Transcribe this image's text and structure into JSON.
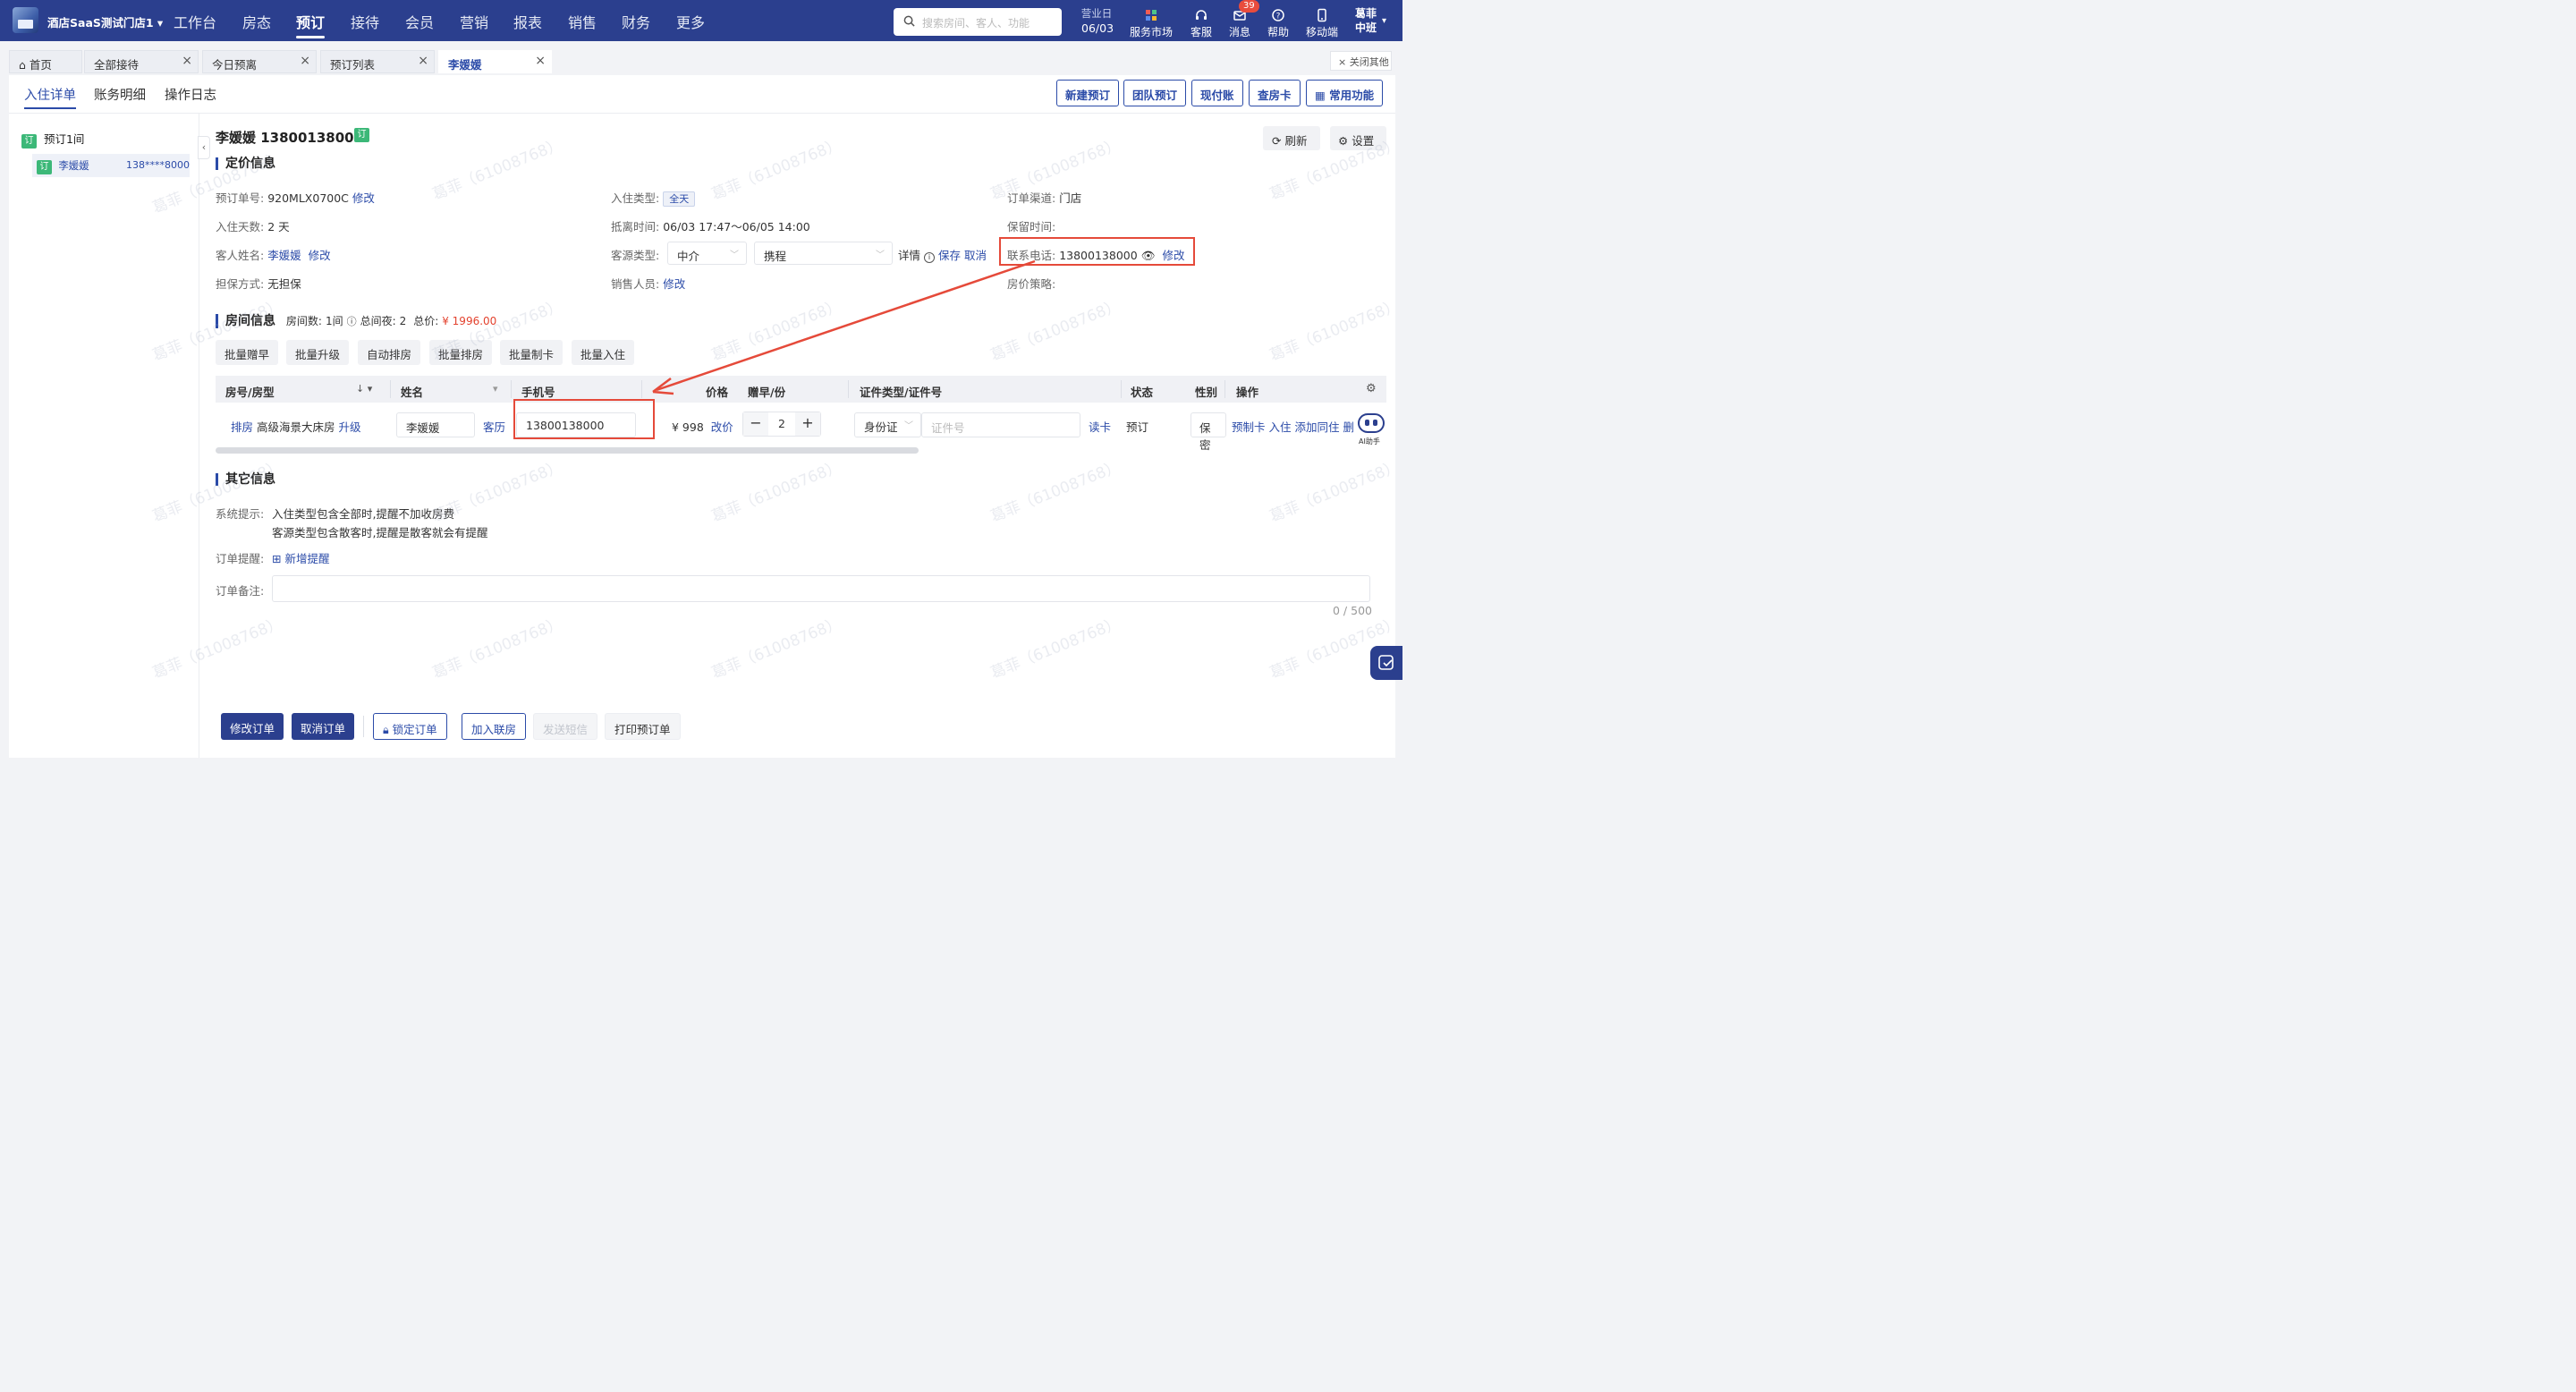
{
  "nav": {
    "store": "酒店SaaS测试门店1",
    "items": [
      "工作台",
      "房态",
      "预订",
      "接待",
      "会员",
      "营销",
      "报表",
      "销售",
      "财务",
      "更多"
    ],
    "search_placeholder": "搜索房间、客人、功能",
    "bizday_label": "营业日",
    "bizday_date": "06/03",
    "tools": [
      "服务市场",
      "客服",
      "消息",
      "帮助",
      "移动端"
    ],
    "msg_badge": "39",
    "user_name": "葛菲",
    "user_shift": "中班"
  },
  "tabs": [
    "首页",
    "全部接待",
    "今日预离",
    "预订列表",
    "李媛媛"
  ],
  "close_others": "× 关闭其他",
  "subtabs": [
    "入住详单",
    "账务明细",
    "操作日志"
  ],
  "actions": [
    "新建预订",
    "团队预订",
    "现付账",
    "查房卡",
    "常用功能"
  ],
  "tree": {
    "root": "预订1间",
    "guest": "李媛媛",
    "phone": "138****8000",
    "tag": "订"
  },
  "header": {
    "name_phone": "李媛媛 13800138000",
    "tag": "订",
    "refresh": "刷新",
    "settings": "设置"
  },
  "pricing": {
    "title": "定价信息",
    "order_no_label": "预订单号:",
    "order_no": "920MLX0700C",
    "modify": "修改",
    "days_label": "入住天数:",
    "days": "2 天",
    "guest_label": "客人姓名:",
    "guest": "李媛媛",
    "guarantee_label": "担保方式:",
    "guarantee": "无担保",
    "checkin_type_label": "入住类型:",
    "checkin_type": "全天",
    "arrive_label": "抵离时间:",
    "arrive": "06/03 17:47～06/05 14:00",
    "source_label": "客源类型:",
    "source1": "中介",
    "source2": "携程",
    "detail": "详情",
    "save": "保存",
    "cancel": "取消",
    "sales_label": "销售人员:",
    "channel_label": "订单渠道:",
    "channel": "门店",
    "retain_label": "保留时间:",
    "contact_label": "联系电话:",
    "contact": "13800138000",
    "policy_label": "房价策略:"
  },
  "room": {
    "title": "房间信息",
    "count_label": "房间数:",
    "count": "1间",
    "nights_label": "总间夜:",
    "nights": "2",
    "total_label": "总价:",
    "total": "¥ 1996.00",
    "batch": [
      "批量赠早",
      "批量升级",
      "自动排房",
      "批量排房",
      "批量制卡",
      "批量入住"
    ],
    "columns": [
      "房号/房型",
      "姓名",
      "手机号",
      "价格",
      "赠早/份",
      "证件类型/证件号",
      "状态",
      "性别",
      "操作"
    ],
    "row": {
      "assign": "排房",
      "type": "高级海景大床房",
      "upgrade": "升级",
      "name": "李媛媛",
      "history": "客历",
      "phone": "13800138000",
      "price": "¥ 998",
      "change_price": "改价",
      "breakfast": "2",
      "id_type": "身份证",
      "id_placeholder": "证件号",
      "read_card": "读卡",
      "status": "预订",
      "gender": "保密",
      "ops": [
        "预制卡",
        "入住",
        "添加同住",
        "删"
      ]
    }
  },
  "other": {
    "title": "其它信息",
    "tip_label": "系统提示:",
    "tip1": "入住类型包含全部时,提醒不加收房费",
    "tip2": "客源类型包含散客时,提醒是散客就会有提醒",
    "remind_label": "订单提醒:",
    "remind_add": "新增提醒",
    "note_label": "订单备注:",
    "note_count": "0 / 500"
  },
  "ai_label": "AI助手",
  "watermark": "葛菲（61008768）",
  "footer": [
    "修改订单",
    "取消订单",
    "锁定订单",
    "加入联房",
    "发送短信",
    "打印预订单"
  ]
}
